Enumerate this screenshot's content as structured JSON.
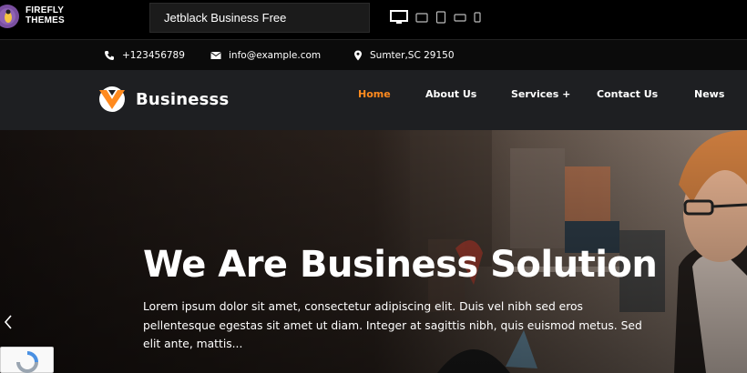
{
  "preview_bar": {
    "logo_line1": "FIREFLY",
    "logo_line2": "THEMES",
    "theme_name": "Jetblack Business Free",
    "device_icons": [
      "desktop-icon",
      "tablet-landscape-icon",
      "tablet-portrait-icon",
      "phone-landscape-icon",
      "phone-portrait-icon"
    ]
  },
  "topbar": {
    "phone": "+123456789",
    "email": "info@example.com",
    "address": "Sumter,SC 29150"
  },
  "header": {
    "brand": "Businesss",
    "nav": [
      "Home",
      "About Us",
      "Services +",
      "Contact Us",
      "News"
    ],
    "active_index": 0
  },
  "hero": {
    "title": "We Are Business Solution",
    "text": "Lorem ipsum dolor sit amet, consectetur adipiscing elit. Duis vel nibh sed eros pellentesque egestas sit amet ut diam. Integer at sagittis nibh, quis euismod metus. Sed elit ante, mattis..."
  },
  "colors": {
    "accent": "#ff8a1e",
    "header_bg": "#1e1f22",
    "topbar_bg": "#0b0b0b"
  }
}
